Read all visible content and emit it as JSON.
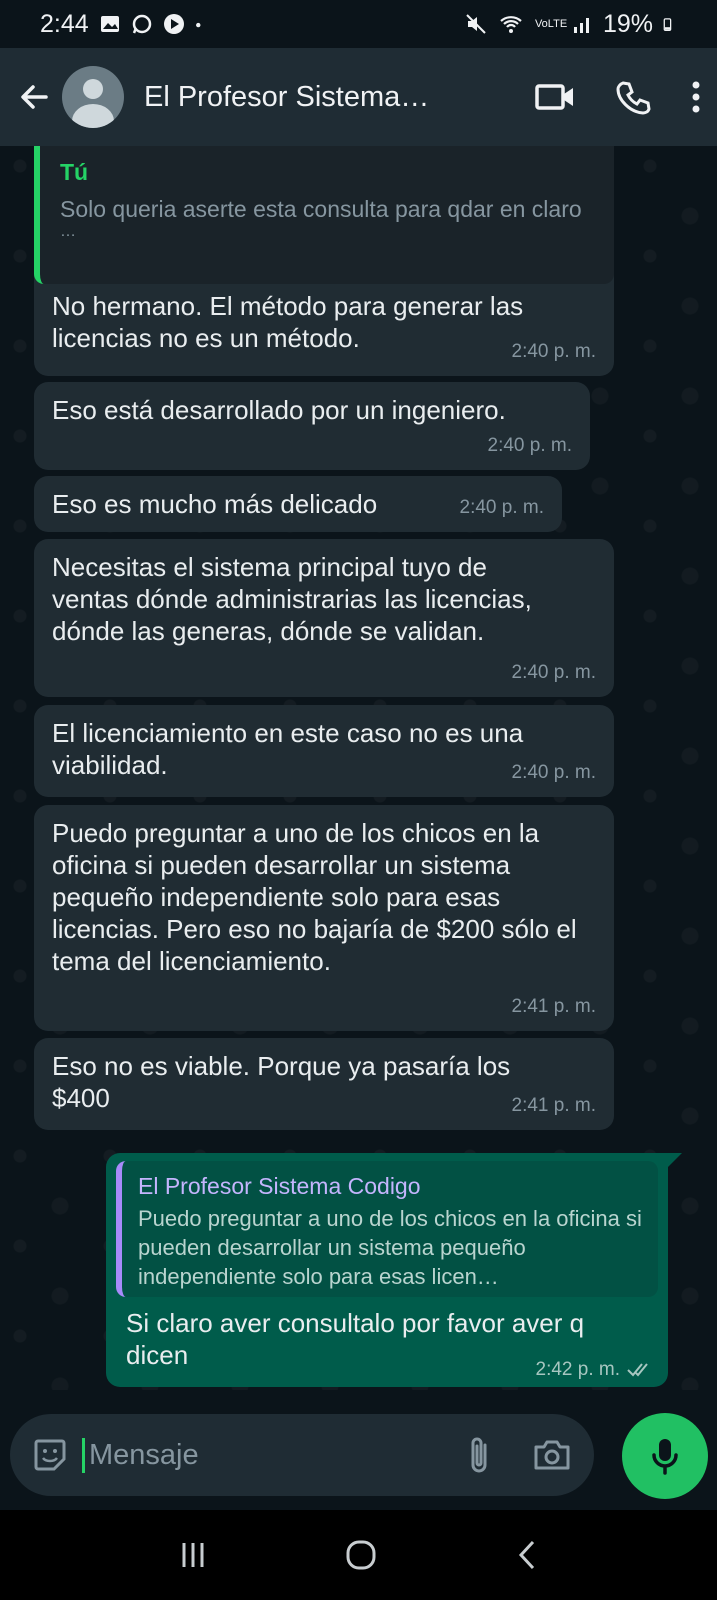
{
  "status_bar": {
    "time": "2:44",
    "battery": "19%",
    "network": "VoLTE"
  },
  "header": {
    "contact_name": "El Profesor Sistema…"
  },
  "quoted_top": {
    "author": "Tú",
    "text": "Solo queria aserte esta consulta para qdar en claro",
    "ellipsis": "…"
  },
  "messages": [
    {
      "text": "No hermano. El método para generar las licencias no es un método.",
      "time": "2:40 p. m."
    },
    {
      "text": "Eso está desarrollado por un ingeniero.",
      "time": "2:40 p. m."
    },
    {
      "text": "Eso es mucho más delicado",
      "time": "2:40 p. m."
    },
    {
      "text": "Necesitas el sistema principal tuyo de ventas dónde administrarias las licencias, dónde las generas, dónde se validan.",
      "time": "2:40 p. m."
    },
    {
      "text": "El licenciamiento en este caso no es una viabilidad.",
      "time": "2:40 p. m."
    },
    {
      "text": "Puedo preguntar a uno de los chicos en la oficina si pueden desarrollar un sistema pequeño independiente solo para esas licencias. Pero eso no bajaría de $200 sólo el tema del licenciamiento.",
      "time": "2:41 p. m."
    },
    {
      "text": "Eso no es viable. Porque ya pasaría los $400",
      "time": "2:41 p. m."
    }
  ],
  "outgoing": {
    "quote_author": "El Profesor Sistema Codigo",
    "quote_text": "Puedo preguntar a uno de los chicos en la oficina si pueden desarrollar un sistema pequeño independiente solo para esas licen…",
    "text": "Si claro aver consultalo por favor aver q dicen",
    "time": "2:42 p. m."
  },
  "composer": {
    "placeholder": "Mensaje"
  },
  "colors": {
    "background": "#0b141a",
    "incoming_bubble": "#202c33",
    "outgoing_bubble": "#005c4b",
    "accent": "#25d366"
  }
}
